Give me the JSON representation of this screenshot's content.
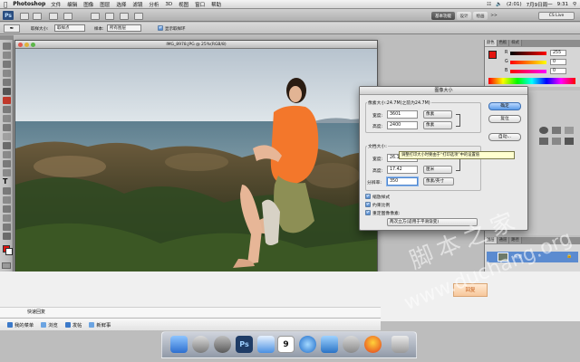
{
  "menubar": {
    "app": "Photoshop",
    "items": [
      "文件",
      "编辑",
      "图像",
      "图层",
      "选择",
      "滤镜",
      "分析",
      "3D",
      "视图",
      "窗口",
      "帮助"
    ],
    "battery": "(2:01)",
    "date": "7月9日周一",
    "time": "9:31"
  },
  "appbar": {
    "logo": "Ps",
    "workspace_buttons": [
      "基本功能",
      "设计",
      "绘画"
    ],
    "more": ">>",
    "cslive": "CS Live"
  },
  "options": {
    "sample_size_label": "取样大小:",
    "sample_size_value": "取样点",
    "sample_label": "样本:",
    "sample_value": "所有图层",
    "show_ring_label": "显示取样环"
  },
  "document": {
    "title": "IMG_8978.JPG @ 25%(RGB/8)",
    "zoom": "25%",
    "doc_info": "文档:24.7M/24.7M"
  },
  "dialog": {
    "title": "图像大小",
    "pixel_dimensions": "像素大小:24.7M(之前为24.7M)",
    "width_label": "宽度:",
    "width_value": "3601",
    "width_unit": "像素",
    "height_label": "高度:",
    "height_value": "2400",
    "height_unit": "像素",
    "document_size": "文档大小:",
    "doc_width_label": "宽度:",
    "doc_width_value": "26.13",
    "doc_height_label": "高度:",
    "doc_height_value": "17.42",
    "doc_height_unit": "厘米",
    "resolution_label": "分辨率:",
    "resolution_value": "350",
    "resolution_unit": "像素/英寸",
    "scale_styles": "缩放样式",
    "constrain": "约束比例",
    "resample": "重定图像像素:",
    "resample_method": "两次立方(适用于平滑渐变)",
    "ok": "确定",
    "reset": "复位",
    "auto": "自动..."
  },
  "tooltip": "调整打印大小时要由于“打印选项”中的设置值",
  "panels": {
    "tabs": [
      "颜色",
      "色板",
      "样式"
    ],
    "r_value": "255",
    "g_value": "0",
    "b_value": "0",
    "layer_tabs": [
      "图层",
      "通道",
      "路径"
    ],
    "layer_name": "背景"
  },
  "web": {
    "reply_title": "快速回复",
    "reply_button": "回复",
    "bottom_items": [
      "我的菜单",
      "浏览",
      "发帖",
      "新鲜事"
    ]
  },
  "dock": {
    "calendar_day": "9"
  },
  "watermark": {
    "line1": "脚本之家",
    "line2": "www.duchang.org"
  },
  "colors": {
    "foreground": "#e3140f",
    "ps_blue": "#2a4d7f",
    "reply_text": "#c25a16"
  }
}
